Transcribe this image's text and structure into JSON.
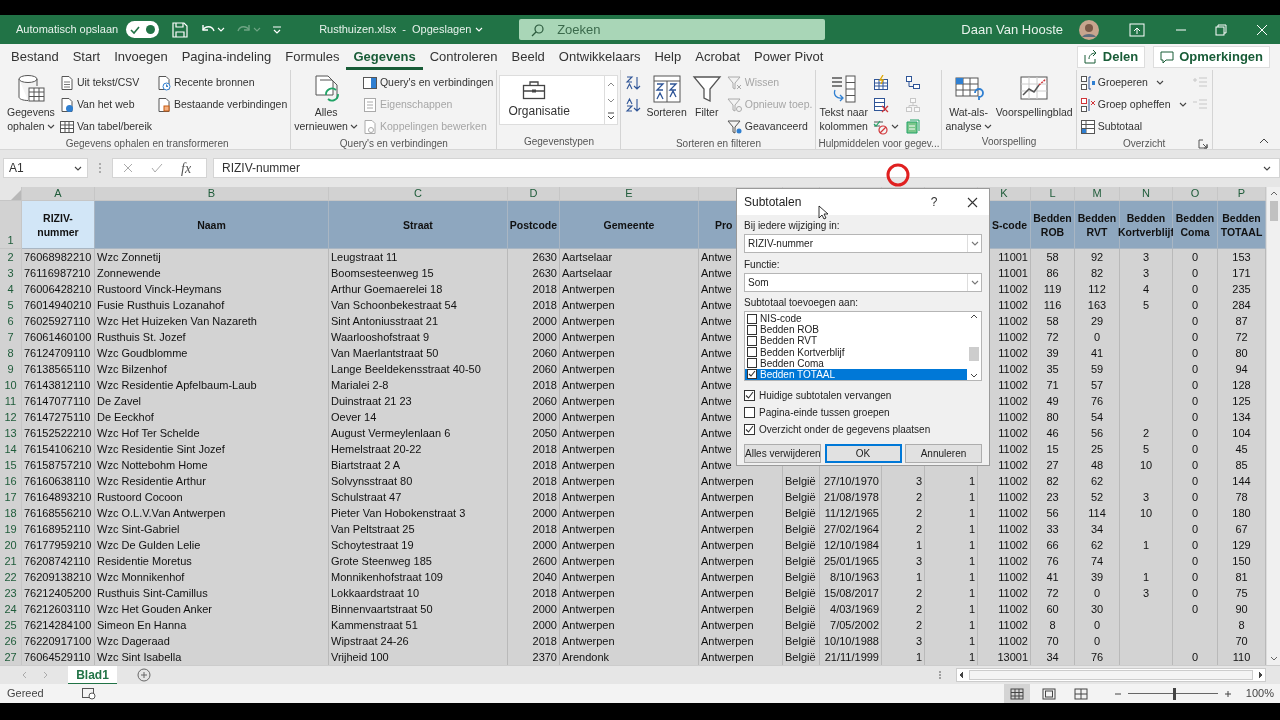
{
  "title_bar": {
    "autosave_label": "Automatisch opslaan",
    "autosave_on": true,
    "title": "Rusthuizen.xlsx  -  Opgeslagen",
    "search": {
      "placeholder": "Zoeken"
    },
    "user": "Daan Van Hooste"
  },
  "tabs": [
    {
      "label": "Bestand",
      "selected": false
    },
    {
      "label": "Start",
      "selected": false
    },
    {
      "label": "Invoegen",
      "selected": false
    },
    {
      "label": "Pagina-indeling",
      "selected": false
    },
    {
      "label": "Formules",
      "selected": false
    },
    {
      "label": "Gegevens",
      "selected": true
    },
    {
      "label": "Controleren",
      "selected": false
    },
    {
      "label": "Beeld",
      "selected": false
    },
    {
      "label": "Ontwikkelaars",
      "selected": false
    },
    {
      "label": "Help",
      "selected": false
    },
    {
      "label": "Acrobat",
      "selected": false
    },
    {
      "label": "Power Pivot",
      "selected": false
    }
  ],
  "share_button": "Delen",
  "comments_button": "Opmerkingen",
  "ribbon": {
    "groups": [
      {
        "label": "Gegevens ophalen en transformeren",
        "columns": [
          {
            "kind": "large",
            "lines": [
              "Gegevens",
              "ophalen"
            ],
            "dropdown": true
          },
          {
            "kind": "stack",
            "items": [
              {
                "kind": "small",
                "label": "Uit tekst/CSV",
                "disabled": false
              },
              {
                "kind": "small",
                "label": "Van het web",
                "disabled": false
              },
              {
                "kind": "small",
                "label": "Van tabel/bereik",
                "disabled": false
              }
            ]
          },
          {
            "kind": "stack",
            "items": [
              {
                "kind": "small",
                "label": "Recente bronnen",
                "disabled": false
              },
              {
                "kind": "small",
                "label": "Bestaande verbindingen",
                "disabled": false
              }
            ]
          }
        ]
      },
      {
        "label": "Query's en verbindingen",
        "columns": [
          {
            "kind": "large",
            "lines": [
              "Alles",
              "vernieuwen"
            ],
            "dropdown": true
          },
          {
            "kind": "stack",
            "items": [
              {
                "kind": "small",
                "label": "Query's en verbindingen",
                "disabled": false
              },
              {
                "kind": "small",
                "label": "Eigenschappen",
                "disabled": true
              },
              {
                "kind": "small",
                "label": "Koppelingen bewerken",
                "disabled": true
              }
            ]
          }
        ]
      },
      {
        "label": "Gegevenstypen",
        "columns": [
          {
            "kind": "gallery",
            "label": "Organisatie"
          }
        ]
      },
      {
        "label": "Sorteren en filteren",
        "columns": [
          {
            "kind": "stack",
            "items": [
              {
                "kind": "icon",
                "disabled": false
              },
              {
                "kind": "icon",
                "disabled": false
              }
            ]
          },
          {
            "kind": "large",
            "lines": [
              "Sorteren"
            ],
            "dropdown": false
          },
          {
            "kind": "large",
            "lines": [
              "Filter"
            ],
            "dropdown": false
          },
          {
            "kind": "stack",
            "items": [
              {
                "kind": "small",
                "label": "Wissen",
                "disabled": true
              },
              {
                "kind": "small",
                "label": "Opnieuw toep.",
                "disabled": true
              },
              {
                "kind": "small",
                "label": "Geavanceerd",
                "disabled": false
              }
            ]
          }
        ]
      },
      {
        "label": "Hulpmiddelen voor gegev...",
        "columns": [
          {
            "kind": "large",
            "lines": [
              "Tekst naar",
              "kolommen"
            ],
            "dropdown": false
          },
          {
            "kind": "stack",
            "items": [
              {
                "kind": "icon",
                "disabled": false
              },
              {
                "kind": "icon",
                "disabled": false
              },
              {
                "kind": "icon",
                "disabled": false,
                "dropdown": true
              }
            ]
          },
          {
            "kind": "stack",
            "items": [
              {
                "kind": "icon",
                "disabled": false
              },
              {
                "kind": "icon",
                "disabled": true
              },
              {
                "kind": "icon",
                "disabled": false
              }
            ]
          }
        ]
      },
      {
        "label": "Voorspelling",
        "columns": [
          {
            "kind": "large",
            "lines": [
              "Wat-als-",
              "analyse"
            ],
            "dropdown": true
          },
          {
            "kind": "large",
            "lines": [
              "Voorspellingblad"
            ],
            "dropdown": false
          }
        ]
      },
      {
        "label": "Overzicht",
        "columns": [
          {
            "kind": "stack",
            "items": [
              {
                "kind": "small",
                "label": "Groeperen",
                "disabled": false,
                "dropdown": true
              },
              {
                "kind": "small",
                "label": "Groep opheffen",
                "disabled": false,
                "dropdown": true
              },
              {
                "kind": "small",
                "label": "Subtotaal",
                "disabled": false
              }
            ]
          },
          {
            "kind": "stack",
            "items": [
              {
                "kind": "icon",
                "disabled": true
              },
              {
                "kind": "icon",
                "disabled": true
              }
            ]
          }
        ]
      }
    ]
  },
  "formula_bar": {
    "name_box": "A1",
    "function_symbol": "fx",
    "formula": "RIZIV-nummer"
  },
  "sheet": {
    "range_selected": true,
    "header_row_number": "1",
    "columns": [
      {
        "letter": "A",
        "heading": "RIZIV-nummer",
        "active": true
      },
      {
        "letter": "B",
        "heading": "Naam",
        "active": false
      },
      {
        "letter": "C",
        "heading": "Straat",
        "active": false
      },
      {
        "letter": "D",
        "heading": "Postcode",
        "active": false
      },
      {
        "letter": "E",
        "heading": "Gemeente",
        "active": false
      },
      {
        "heading": "Pro",
        "active": false
      },
      {},
      {},
      {},
      {},
      {
        "letter": "K",
        "heading": "S-code",
        "active": false
      },
      {
        "letter": "L",
        "heading": "Bedden ROB",
        "active": false
      },
      {
        "letter": "M",
        "heading": "Bedden RVT",
        "active": false
      },
      {
        "letter": "N",
        "heading": "Bedden Kortverblijf",
        "active": false
      },
      {
        "letter": "O",
        "heading": "Bedden Coma",
        "active": false
      },
      {
        "letter": "P",
        "heading": "Bedden TOTAAL",
        "active": false
      }
    ],
    "rows": [
      {
        "number": "2",
        "cells": [
          "76068982210",
          "Wzc Zonnetij",
          "Leugstraat 11",
          "2630",
          "Aartselaar",
          "Antwe",
          null,
          null,
          null,
          null,
          "11001",
          "58",
          "92",
          "3",
          "0",
          "153"
        ]
      },
      {
        "number": "3",
        "cells": [
          "76116987210",
          "Zonnewende",
          "Boomsesteenweg 15",
          "2630",
          "Aartselaar",
          "Antwe",
          null,
          null,
          null,
          null,
          "11001",
          "86",
          "82",
          "3",
          "0",
          "171"
        ]
      },
      {
        "number": "4",
        "cells": [
          "76006428210",
          "Rustoord Vinck-Heymans",
          "Arthur Goemaerelei 18",
          "2018",
          "Antwerpen",
          "Antwe",
          null,
          null,
          null,
          null,
          "11002",
          "119",
          "112",
          "4",
          "0",
          "235"
        ]
      },
      {
        "number": "5",
        "cells": [
          "76014940210",
          "Fusie Rusthuis Lozanahof",
          "Van Schoonbekestraat 54",
          "2018",
          "Antwerpen",
          "Antwe",
          null,
          null,
          null,
          null,
          "11002",
          "116",
          "163",
          "5",
          "0",
          "284"
        ]
      },
      {
        "number": "6",
        "cells": [
          "76025927110",
          "Wzc Het Huizeken Van Nazareth",
          "Sint Antoniusstraat 21",
          "2000",
          "Antwerpen",
          "Antwe",
          null,
          null,
          null,
          null,
          "11002",
          "58",
          "29",
          null,
          "0",
          "87"
        ]
      },
      {
        "number": "7",
        "cells": [
          "76061460100",
          "Rusthuis St. Jozef",
          "Waarlooshofstraat 9",
          "2000",
          "Antwerpen",
          "Antwe",
          null,
          null,
          null,
          null,
          "11002",
          "72",
          "0",
          null,
          "0",
          "72"
        ]
      },
      {
        "number": "8",
        "cells": [
          "76124709110",
          "Wzc Goudblomme",
          "Van Maerlantstraat 50",
          "2060",
          "Antwerpen",
          "Antwe",
          null,
          null,
          null,
          null,
          "11002",
          "39",
          "41",
          null,
          "0",
          "80"
        ]
      },
      {
        "number": "9",
        "cells": [
          "76138565110",
          "Wzc Bilzenhof",
          "Lange Beeldekensstraat 40-50",
          "2060",
          "Antwerpen",
          "Antwe",
          null,
          null,
          null,
          null,
          "11002",
          "35",
          "59",
          null,
          "0",
          "94"
        ]
      },
      {
        "number": "10",
        "cells": [
          "76143812110",
          "Wzc Residentie Apfelbaum-Laub",
          "Marialei 2-8",
          "2018",
          "Antwerpen",
          "Antwe",
          null,
          null,
          null,
          null,
          "11002",
          "71",
          "57",
          null,
          "0",
          "128"
        ]
      },
      {
        "number": "11",
        "cells": [
          "76147077110",
          "De Zavel",
          "Duinstraat 21 23",
          "2060",
          "Antwerpen",
          "Antwe",
          null,
          null,
          null,
          null,
          "11002",
          "49",
          "76",
          null,
          "0",
          "125"
        ]
      },
      {
        "number": "12",
        "cells": [
          "76147275110",
          "De Eeckhof",
          "Oever 14",
          "2000",
          "Antwerpen",
          "Antwe",
          null,
          null,
          null,
          null,
          "11002",
          "80",
          "54",
          null,
          "0",
          "134"
        ]
      },
      {
        "number": "13",
        "cells": [
          "76152522210",
          "Wzc Hof Ter Schelde",
          "August Vermeylenlaan 6",
          "2050",
          "Antwerpen",
          "Antwe",
          null,
          null,
          null,
          null,
          "11002",
          "46",
          "56",
          "2",
          "0",
          "104"
        ]
      },
      {
        "number": "14",
        "cells": [
          "76154106210",
          "Wzc Residentie Sint Jozef",
          "Hemelstraat 20-22",
          "2018",
          "Antwerpen",
          "Antwe",
          null,
          null,
          null,
          null,
          "11002",
          "15",
          "25",
          "5",
          "0",
          "45"
        ]
      },
      {
        "number": "15",
        "cells": [
          "76158757210",
          "Wzc Nottebohm Home",
          "Biartstraat 2 A",
          "2018",
          "Antwerpen",
          "Antwe",
          null,
          null,
          null,
          null,
          "11002",
          "27",
          "48",
          "10",
          "0",
          "85"
        ]
      },
      {
        "number": "16",
        "cells": [
          "76160638110",
          "Wzc Residentie Arthur",
          "Solvynsstraat 80",
          "2018",
          "Antwerpen",
          "Antwerpen",
          "België",
          "27/10/1970",
          "3",
          "1",
          "11002",
          "82",
          "62",
          null,
          "0",
          "144"
        ]
      },
      {
        "number": "17",
        "cells": [
          "76164893210",
          "Rustoord Cocoon",
          "Schulstraat 47",
          "2018",
          "Antwerpen",
          "Antwerpen",
          "België",
          "21/08/1978",
          "2",
          "1",
          "11002",
          "23",
          "52",
          "3",
          "0",
          "78"
        ]
      },
      {
        "number": "18",
        "cells": [
          "76168556210",
          "Wzc O.L.V.Van Antwerpen",
          "Pieter Van Hobokenstraat 3",
          "2000",
          "Antwerpen",
          "Antwerpen",
          "België",
          "11/12/1965",
          "2",
          "1",
          "11002",
          "56",
          "114",
          "10",
          "0",
          "180"
        ]
      },
      {
        "number": "19",
        "cells": [
          "76168952110",
          "Wzc Sint-Gabriel",
          "Van Peltstraat 25",
          "2018",
          "Antwerpen",
          "Antwerpen",
          "België",
          "27/02/1964",
          "2",
          "1",
          "11002",
          "33",
          "34",
          null,
          "0",
          "67"
        ]
      },
      {
        "number": "20",
        "cells": [
          "76177959210",
          "Wzc De Gulden Lelie",
          "Schoytestraat 19",
          "2000",
          "Antwerpen",
          "Antwerpen",
          "België",
          "12/10/1984",
          "1",
          "1",
          "11002",
          "66",
          "62",
          "1",
          "0",
          "129"
        ]
      },
      {
        "number": "21",
        "cells": [
          "76208742110",
          "Residentie Moretus",
          "Grote Steenweg 185",
          "2600",
          "Antwerpen",
          "Antwerpen",
          "België",
          "25/01/1965",
          "3",
          "1",
          "11002",
          "76",
          "74",
          null,
          "0",
          "150"
        ]
      },
      {
        "number": "22",
        "cells": [
          "76209138210",
          "Wzc Monnikenhof",
          "Monnikenhofstraat 109",
          "2040",
          "Antwerpen",
          "Antwerpen",
          "België",
          "8/10/1963",
          "1",
          "1",
          "11002",
          "41",
          "39",
          "1",
          "0",
          "81"
        ]
      },
      {
        "number": "23",
        "cells": [
          "76212405200",
          "Rusthuis Sint-Camillus",
          "Lokkaardstraat 10",
          "2018",
          "Antwerpen",
          "Antwerpen",
          "België",
          "15/08/2017",
          "2",
          "1",
          "11002",
          "72",
          "0",
          "3",
          "0",
          "75"
        ]
      },
      {
        "number": "24",
        "cells": [
          "76212603110",
          "Wzc Het Gouden Anker",
          "Binnenvaartstraat 50",
          "2000",
          "Antwerpen",
          "Antwerpen",
          "België",
          "4/03/1969",
          "2",
          "1",
          "11002",
          "60",
          "30",
          null,
          "0",
          "90"
        ]
      },
      {
        "number": "25",
        "cells": [
          "76214284100",
          "Simeon En Hanna",
          "Kammenstraat 51",
          "2000",
          "Antwerpen",
          "Antwerpen",
          "België",
          "7/05/2002",
          "2",
          "1",
          "11002",
          "8",
          "0",
          null,
          null,
          "8"
        ]
      },
      {
        "number": "26",
        "cells": [
          "76220917100",
          "Wzc Dageraad",
          "Wipstraat 24-26",
          "2018",
          "Antwerpen",
          "Antwerpen",
          "België",
          "10/10/1988",
          "3",
          "1",
          "11002",
          "70",
          "0",
          null,
          null,
          "70"
        ]
      },
      {
        "number": "27",
        "cells": [
          "76064529110",
          "Wzc Sint Isabella",
          "Vrijheid 100",
          "2370",
          "Arendonk",
          "Antwerpen",
          "België",
          "21/11/1999",
          "1",
          "1",
          "13001",
          "34",
          "76",
          null,
          "0",
          "110"
        ]
      }
    ]
  },
  "dialog": {
    "title": "Subtotalen",
    "help": "?",
    "change_label": "Bij iedere wijziging in:",
    "change_value": "RIZIV-nummer",
    "function_label": "Functie:",
    "function_value": "Som",
    "add_label": "Subtotaal toevoegen aan:",
    "add_items": [
      {
        "label": "NIS-code",
        "checked": false,
        "selected": false
      },
      {
        "label": "Bedden ROB",
        "checked": false,
        "selected": false
      },
      {
        "label": "Bedden RVT",
        "checked": false,
        "selected": false
      },
      {
        "label": "Bedden Kortverblijf",
        "checked": false,
        "selected": false
      },
      {
        "label": "Bedden Coma",
        "checked": false,
        "selected": false
      },
      {
        "label": "Bedden TOTAAL",
        "checked": true,
        "selected": true
      }
    ],
    "options": [
      {
        "label": "Huidige subtotalen vervangen",
        "checked": true
      },
      {
        "label": "Pagina-einde tussen groepen",
        "checked": false
      },
      {
        "label": "Overzicht onder de gegevens plaatsen",
        "checked": true
      }
    ],
    "buttons": [
      {
        "label": "Alles verwijderen",
        "default": false
      },
      {
        "label": "OK",
        "default": true
      },
      {
        "label": "Annuleren",
        "default": false
      }
    ]
  },
  "sheet_tabs": [
    {
      "label": "Blad1",
      "selected": true
    }
  ],
  "status_bar": {
    "text": "Gereed",
    "views": [
      {
        "selected": true
      },
      {
        "selected": false
      },
      {
        "selected": false
      }
    ],
    "zoom_slider": {
      "level": 0.5
    },
    "zoom": "100%"
  }
}
